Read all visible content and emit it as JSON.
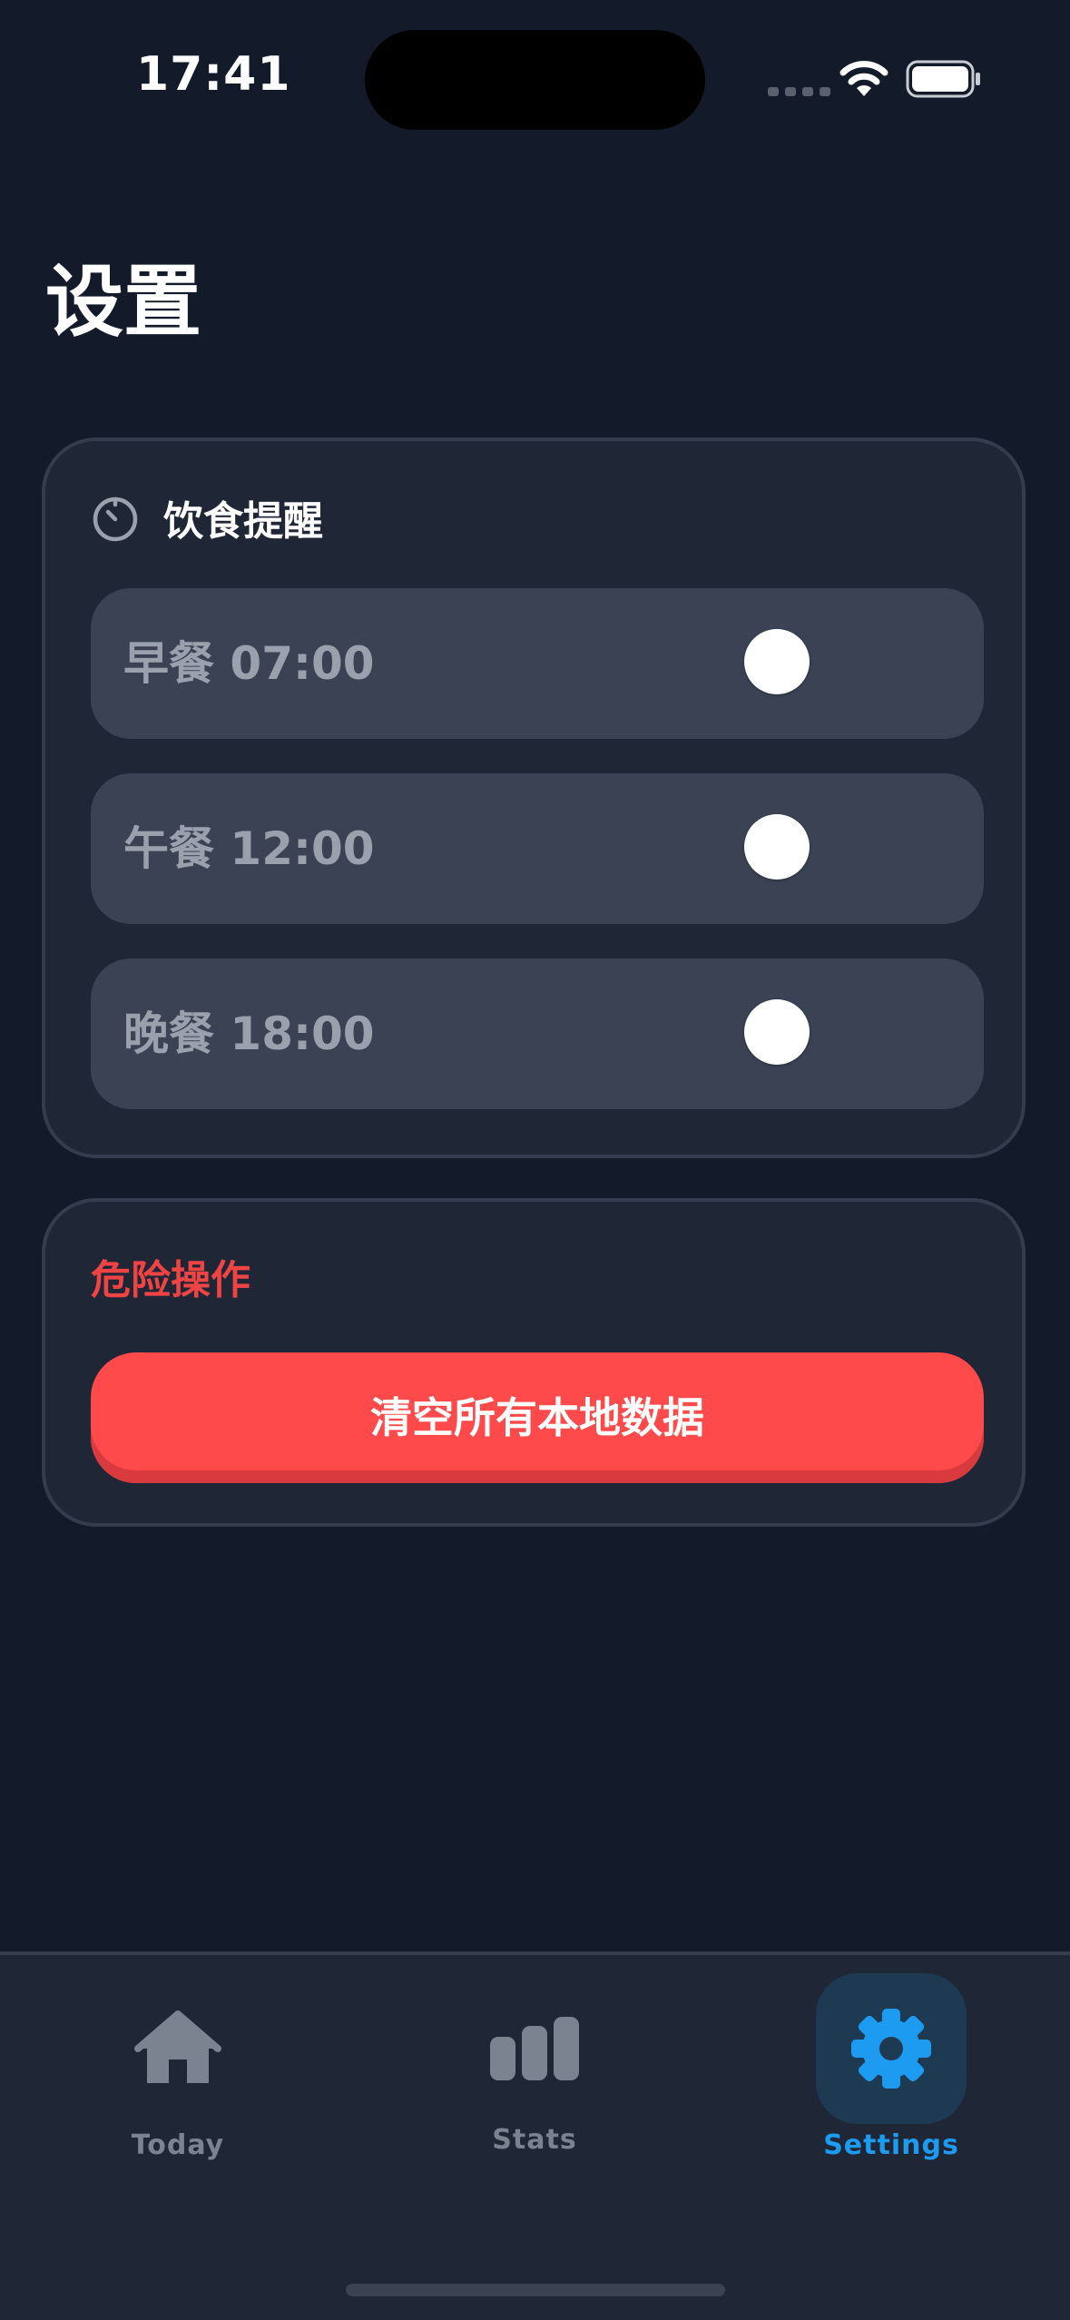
{
  "status_bar": {
    "time": "17:41"
  },
  "page": {
    "title": "设置"
  },
  "reminders": {
    "title": "饮食提醒",
    "icon": "timer-icon",
    "items": [
      {
        "label": "早餐 07:00",
        "enabled": false
      },
      {
        "label": "午餐 12:00",
        "enabled": false
      },
      {
        "label": "晚餐 18:00",
        "enabled": false
      }
    ]
  },
  "danger": {
    "title": "危险操作",
    "button_label": "清空所有本地数据",
    "accent_color": "#ef4444"
  },
  "tab_bar": {
    "active": "Settings",
    "accent_color": "#1d9bf0",
    "tabs": [
      {
        "label": "Today",
        "icon": "home-icon"
      },
      {
        "label": "Stats",
        "icon": "bar-chart-icon"
      },
      {
        "label": "Settings",
        "icon": "gear-icon"
      }
    ]
  }
}
